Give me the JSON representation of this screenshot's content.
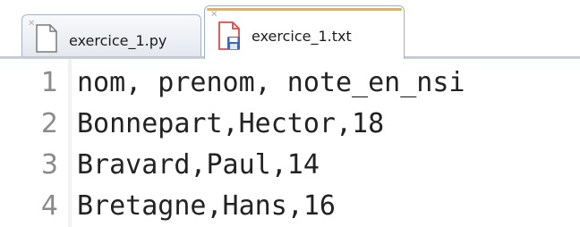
{
  "tabs": [
    {
      "label": "exercice_1.py",
      "icon": "text-file-icon",
      "active": false
    },
    {
      "label": "exercice_1.txt",
      "icon": "saved-text-file-icon",
      "active": true
    }
  ],
  "editor": {
    "line_numbers": [
      "1",
      "2",
      "3",
      "4"
    ],
    "lines": [
      "nom, prenom, note_en_nsi",
      "Bonnepart,Hector,18",
      "Bravard,Paul,14",
      "Bretagne,Hans,16"
    ]
  },
  "colors": {
    "active_tab_accent": "#f2b136",
    "tab_border": "#a9b3c0",
    "line_number_text": "#8a8a8a",
    "code_text": "#222222",
    "save_icon": "#e04a4a"
  }
}
